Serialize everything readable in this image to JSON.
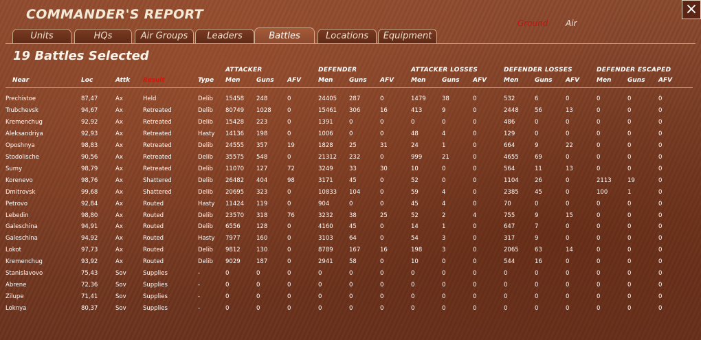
{
  "window": {
    "title": "COMMANDER'S REPORT",
    "close_glyph": "×"
  },
  "mode": {
    "ground": "Ground",
    "air": "Air"
  },
  "tabs": [
    "Units",
    "HQs",
    "Air Groups",
    "Leaders",
    "Battles",
    "Locations",
    "Equipment"
  ],
  "active_tab": "Battles",
  "subtitle": "19 Battles Selected",
  "groups": [
    "ATTACKER",
    "DEFENDER",
    "ATTACKER LOSSES",
    "DEFENDER LOSSES",
    "DEFENDER ESCAPED"
  ],
  "columns": [
    "Near",
    "Loc",
    "Attk",
    "Result",
    "Type",
    "Men",
    "Guns",
    "AFV",
    "Men",
    "Guns",
    "AFV",
    "Men",
    "Guns",
    "AFV",
    "Men",
    "Guns",
    "AFV",
    "Men",
    "Guns",
    "AFV"
  ],
  "colors": {
    "result_header": "#d0180f",
    "ground_mode": "#c0140f",
    "background": "#7d3f26"
  },
  "rows": [
    [
      "Prechistoe",
      "87,47",
      "Ax",
      "Held",
      "Delib",
      "15458",
      "248",
      "0",
      "24405",
      "287",
      "0",
      "1479",
      "38",
      "0",
      "532",
      "6",
      "0",
      "0",
      "0",
      "0"
    ],
    [
      "Trubchevsk",
      "94,67",
      "Ax",
      "Retreated",
      "Delib",
      "80749",
      "1028",
      "0",
      "15461",
      "306",
      "16",
      "413",
      "9",
      "0",
      "2448",
      "56",
      "13",
      "0",
      "0",
      "0"
    ],
    [
      "Kremenchug",
      "92,92",
      "Ax",
      "Retreated",
      "Delib",
      "15428",
      "223",
      "0",
      "1391",
      "0",
      "0",
      "0",
      "0",
      "0",
      "486",
      "0",
      "0",
      "0",
      "0",
      "0"
    ],
    [
      "Aleksandriya",
      "92,93",
      "Ax",
      "Retreated",
      "Hasty",
      "14136",
      "198",
      "0",
      "1006",
      "0",
      "0",
      "48",
      "4",
      "0",
      "129",
      "0",
      "0",
      "0",
      "0",
      "0"
    ],
    [
      "Oposhnya",
      "98,83",
      "Ax",
      "Retreated",
      "Delib",
      "24555",
      "357",
      "19",
      "1828",
      "25",
      "31",
      "24",
      "1",
      "0",
      "664",
      "9",
      "22",
      "0",
      "0",
      "0"
    ],
    [
      "Stodolische",
      "90,56",
      "Ax",
      "Retreated",
      "Delib",
      "35575",
      "548",
      "0",
      "21312",
      "232",
      "0",
      "999",
      "21",
      "0",
      "4655",
      "69",
      "0",
      "0",
      "0",
      "0"
    ],
    [
      "Sumy",
      "98,79",
      "Ax",
      "Retreated",
      "Delib",
      "11070",
      "127",
      "72",
      "3249",
      "33",
      "30",
      "10",
      "0",
      "0",
      "564",
      "11",
      "13",
      "0",
      "0",
      "0"
    ],
    [
      "Korenevo",
      "98,76",
      "Ax",
      "Shattered",
      "Delib",
      "26482",
      "404",
      "98",
      "3171",
      "45",
      "0",
      "52",
      "0",
      "0",
      "1104",
      "26",
      "0",
      "2113",
      "19",
      "0"
    ],
    [
      "Dmitrovsk",
      "99,68",
      "Ax",
      "Shattered",
      "Delib",
      "20695",
      "323",
      "0",
      "10833",
      "104",
      "0",
      "59",
      "4",
      "0",
      "2385",
      "45",
      "0",
      "100",
      "1",
      "0"
    ],
    [
      "Petrovo",
      "92,84",
      "Ax",
      "Routed",
      "Hasty",
      "11424",
      "119",
      "0",
      "904",
      "0",
      "0",
      "45",
      "4",
      "0",
      "70",
      "0",
      "0",
      "0",
      "0",
      "0"
    ],
    [
      "Lebedin",
      "98,80",
      "Ax",
      "Routed",
      "Delib",
      "23570",
      "318",
      "76",
      "3232",
      "38",
      "25",
      "52",
      "2",
      "4",
      "755",
      "9",
      "15",
      "0",
      "0",
      "0"
    ],
    [
      "Galeschina",
      "94,91",
      "Ax",
      "Routed",
      "Delib",
      "6556",
      "128",
      "0",
      "4160",
      "45",
      "0",
      "14",
      "1",
      "0",
      "647",
      "7",
      "0",
      "0",
      "0",
      "0"
    ],
    [
      "Galeschina",
      "94,92",
      "Ax",
      "Routed",
      "Hasty",
      "7977",
      "160",
      "0",
      "3103",
      "64",
      "0",
      "54",
      "3",
      "0",
      "317",
      "9",
      "0",
      "0",
      "0",
      "0"
    ],
    [
      "Lokot",
      "97,73",
      "Ax",
      "Routed",
      "Delib",
      "9812",
      "130",
      "0",
      "8789",
      "167",
      "16",
      "198",
      "3",
      "0",
      "2065",
      "63",
      "14",
      "0",
      "0",
      "0"
    ],
    [
      "Kremenchug",
      "93,92",
      "Ax",
      "Routed",
      "Delib",
      "9029",
      "187",
      "0",
      "2941",
      "58",
      "0",
      "10",
      "0",
      "0",
      "544",
      "16",
      "0",
      "0",
      "0",
      "0"
    ],
    [
      "Stanislavovo",
      "75,43",
      "Sov",
      "Supplies",
      "-",
      "0",
      "0",
      "0",
      "0",
      "0",
      "0",
      "0",
      "0",
      "0",
      "0",
      "0",
      "0",
      "0",
      "0",
      "0"
    ],
    [
      "Abrene",
      "72,36",
      "Sov",
      "Supplies",
      "-",
      "0",
      "0",
      "0",
      "0",
      "0",
      "0",
      "0",
      "0",
      "0",
      "0",
      "0",
      "0",
      "0",
      "0",
      "0"
    ],
    [
      "Zilupe",
      "71,41",
      "Sov",
      "Supplies",
      "-",
      "0",
      "0",
      "0",
      "0",
      "0",
      "0",
      "0",
      "0",
      "0",
      "0",
      "0",
      "0",
      "0",
      "0",
      "0"
    ],
    [
      "Loknya",
      "80,37",
      "Sov",
      "Supplies",
      "-",
      "0",
      "0",
      "0",
      "0",
      "0",
      "0",
      "0",
      "0",
      "0",
      "0",
      "0",
      "0",
      "0",
      "0",
      "0"
    ]
  ]
}
